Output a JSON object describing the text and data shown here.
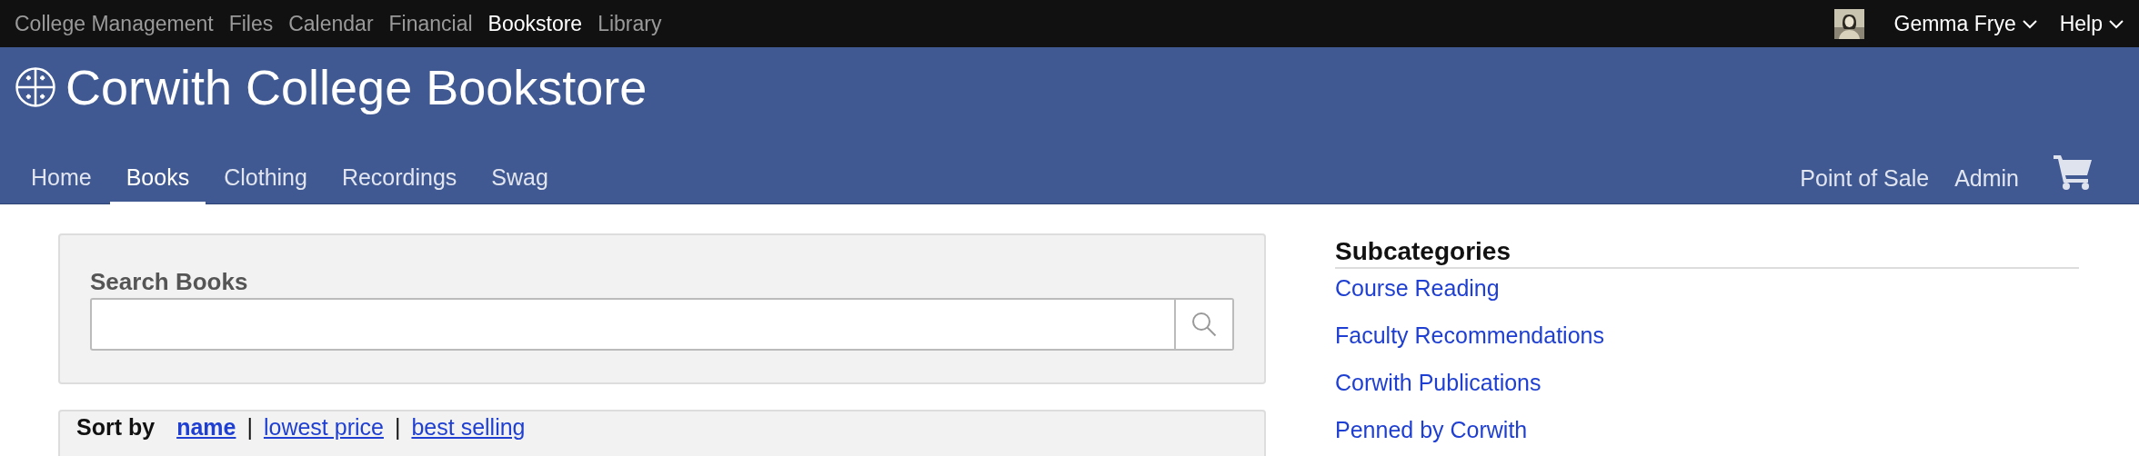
{
  "top_bar": {
    "apps": [
      {
        "label": "College Management",
        "selected": false
      },
      {
        "label": "Files",
        "selected": false
      },
      {
        "label": "Calendar",
        "selected": false
      },
      {
        "label": "Financial",
        "selected": false
      },
      {
        "label": "Bookstore",
        "selected": true
      },
      {
        "label": "Library",
        "selected": false
      }
    ],
    "user": {
      "name": "Gemma Frye"
    },
    "help": {
      "label": "Help"
    }
  },
  "header": {
    "title": "Corwith College Bookstore",
    "nav": [
      {
        "label": "Home",
        "selected": false
      },
      {
        "label": "Books",
        "selected": true
      },
      {
        "label": "Clothing",
        "selected": false
      },
      {
        "label": "Recordings",
        "selected": false
      },
      {
        "label": "Swag",
        "selected": false
      }
    ],
    "right_nav": [
      "Point of Sale",
      "Admin"
    ]
  },
  "search": {
    "label": "Search Books"
  },
  "sort": {
    "label": "Sort by",
    "separators": [
      "|",
      "|"
    ],
    "options": [
      {
        "label": "name",
        "selected": true
      },
      {
        "label": "lowest price",
        "selected": false
      },
      {
        "label": "best selling",
        "selected": false
      }
    ]
  },
  "sidebar": {
    "heading": "Subcategories",
    "items": [
      "Course Reading",
      "Faculty Recommendations",
      "Corwith Publications",
      "Penned by Corwith"
    ]
  }
}
